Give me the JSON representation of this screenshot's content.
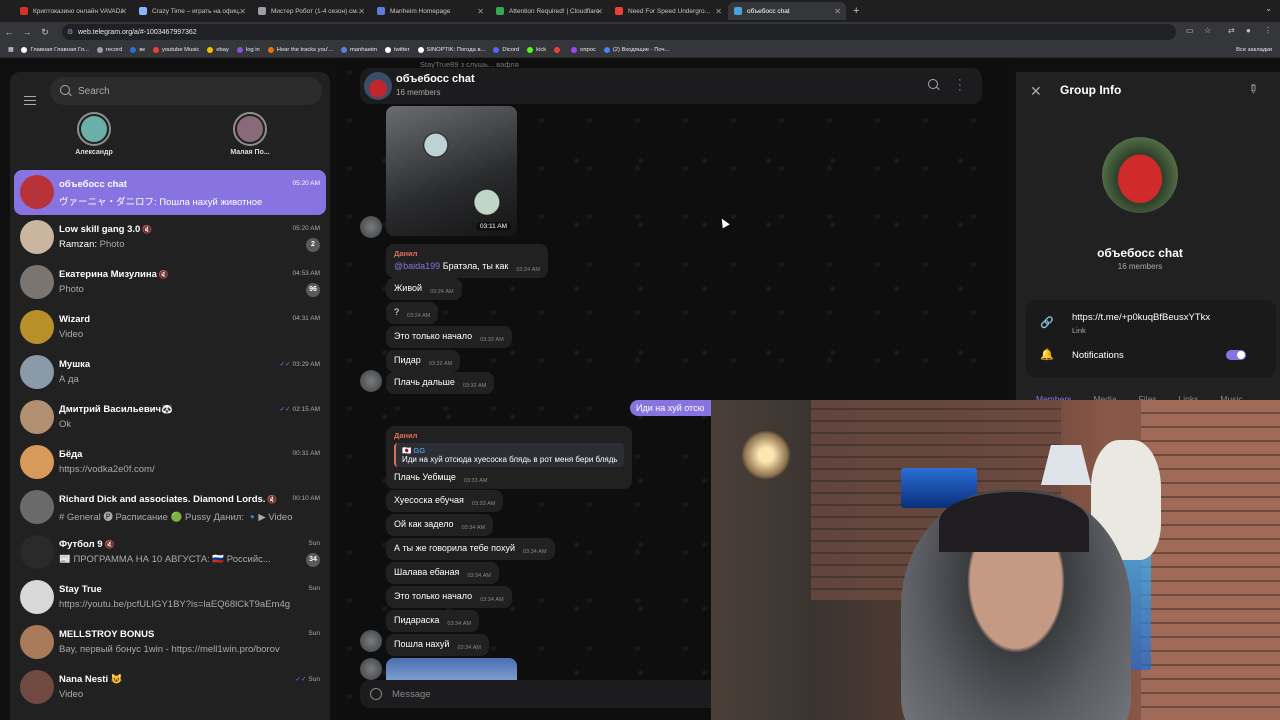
{
  "browser": {
    "tabs": [
      {
        "title": "Криптоказино онлайн VAVADA",
        "color": "#d93025"
      },
      {
        "title": "Crazy Time – играть на офиц...",
        "color": "#8ab4f8"
      },
      {
        "title": "Мистер Робот (1-4 сезон) см...",
        "color": "#9aa0a6"
      },
      {
        "title": "Manheim Homepage",
        "color": "#5b7fd6"
      },
      {
        "title": "Attention Required! | Cloudflare",
        "color": "#34a853"
      },
      {
        "title": "Need For Speed Undergro...",
        "color": "#ea4335"
      },
      {
        "title": "объебосс chat",
        "color": "#4aa3df"
      }
    ],
    "url": "web.telegram.org/a/#-1003467997362",
    "bookmarks": [
      {
        "label": "Главная Главная Гл...",
        "color": "#fff"
      },
      {
        "label": "record",
        "color": "#9aa0a6"
      },
      {
        "label": "вк",
        "color": "#2a6fd6"
      },
      {
        "label": "youtube Music",
        "color": "#ea4335"
      },
      {
        "label": "ebay",
        "color": "#fbbc04"
      },
      {
        "label": "log in",
        "color": "#8a4de0"
      },
      {
        "label": "Hear the tracks you'...",
        "color": "#e8710a"
      },
      {
        "label": "manhaeim",
        "color": "#5b7fd6"
      },
      {
        "label": "twitter",
        "color": "#fff"
      },
      {
        "label": "SINOPTIK: Погода в...",
        "color": "#fff"
      },
      {
        "label": "Dicord",
        "color": "#5865f2"
      },
      {
        "label": "kick",
        "color": "#53fc18"
      },
      {
        "label": "",
        "color": "#ea4335"
      },
      {
        "label": "опрос",
        "color": "#a142f4"
      },
      {
        "label": "(2) Входящие - Поч...",
        "color": "#4285f4"
      }
    ],
    "all_bookmarks": "Все закладки"
  },
  "sidebar": {
    "search_placeholder": "Search",
    "stories": [
      {
        "name": "Александр",
        "color": "#6ab0a8"
      },
      {
        "name": "Малая По...",
        "color": "#8a6a7a"
      }
    ],
    "chats": [
      {
        "name": "объебосс chat",
        "preview": "ヴァーニャ・ダニロフ: Пошла нахуй животное",
        "time": "05:20 AM",
        "badge": "",
        "avatar": "#b8323a",
        "muted": false,
        "active": true
      },
      {
        "name": "Low skill gang 3.0",
        "sender": "Ramzan:",
        "preview": "Photo",
        "time": "05:20 AM",
        "badge": "2",
        "avatar": "#c9b5a0",
        "muted": true
      },
      {
        "name": "Екатерина Мизулина",
        "preview": "Photo",
        "time": "04:53 AM",
        "badge": "96",
        "avatar": "#7a7570",
        "muted": true
      },
      {
        "name": "Wizard",
        "preview": "Video",
        "time": "04:31 AM",
        "badge": "",
        "avatar": "#b8902a",
        "muted": false
      },
      {
        "name": "Мушка",
        "preview": "А да",
        "time": "03:29 AM",
        "badge": "",
        "avatar": "#8a9aa8",
        "muted": false,
        "read": true
      },
      {
        "name": "Дмитрий Васильевич🐼",
        "preview": "Ok",
        "time": "02:15 AM",
        "badge": "",
        "avatar": "#b09070",
        "muted": false,
        "read": true
      },
      {
        "name": "Бёда",
        "preview": "https://vodka2e0f.com/",
        "time": "00:31 AM",
        "badge": "",
        "avatar": "#d89a5a",
        "muted": false
      },
      {
        "name": "Richard Dick and associates. Diamond Lords.",
        "preview": "# General 🅟 Расписание 🟢 Pussy",
        "preview2": "Данил: 🔹▶ Video",
        "time": "00:10 AM",
        "badge": "",
        "avatar": "#6a6a6a",
        "muted": true
      },
      {
        "name": "Футбол 9",
        "preview": "📰 ПРОГРАММА НА 10 АВГУСТА: 🇷🇺 Российс...",
        "time": "Sun",
        "badge": "34",
        "avatar": "#2a2a2a",
        "muted": true
      },
      {
        "name": "Stay True",
        "preview": "https://youtu.be/pcfULIGY1BY?is=laEQ68lCkT9aEm4g",
        "time": "Sun",
        "badge": "",
        "avatar": "#d8d8d8",
        "muted": false
      },
      {
        "name": "MELLSTROY BONUS",
        "preview": "Bay, первый бонус 1win - https://mell1win.pro/borov",
        "time": "Sun",
        "badge": "",
        "avatar": "#a87a5a",
        "muted": false
      },
      {
        "name": "Nana Nesti 😺",
        "preview": "Video",
        "time": "Sun",
        "badge": "",
        "avatar": "#704a40",
        "muted": false,
        "read": true
      }
    ]
  },
  "chat": {
    "title": "объебосс chat",
    "members": "16 members",
    "header_sender": "StayTrue89 з слушь...  вафля",
    "photo_time": "03:11 AM",
    "messages": [
      {
        "author": "Данил",
        "mention": "@baida199",
        "text": "Братэла, ты как",
        "time": "03:24 AM"
      },
      {
        "text": "Живой",
        "time": "03:24 AM"
      },
      {
        "text": "?",
        "time": "03:24 AM"
      },
      {
        "text": "Это только начало",
        "time": "03:32 AM"
      },
      {
        "text": "Пидар",
        "time": "03:32 AM"
      },
      {
        "text": "Плачь дальше",
        "time": "03:32 AM"
      },
      {
        "text": "Иди на хуй отсю",
        "time": "",
        "out": true
      },
      {
        "author": "Данил",
        "reply_name": "🇯🇵 GG",
        "reply_text": "Иди на хуй отсюда хуесоска блядь в рот меня бери блядь",
        "text": "Плачь Уебмще",
        "time": "03:33 AM"
      },
      {
        "text": "Хуесоска ебучая",
        "time": "03:33 AM"
      },
      {
        "text": "Ой как задело",
        "time": "03:34 AM"
      },
      {
        "text": "А ты же говорила тебе похуй",
        "time": "03:34 AM"
      },
      {
        "text": "Шалава ебаная",
        "time": "03:34 AM"
      },
      {
        "text": "Это только начало",
        "time": "03:34 AM"
      },
      {
        "text": "Пидараска",
        "time": "03:34 AM"
      },
      {
        "text": "Пошла нахуй",
        "time": "03:34 AM"
      }
    ],
    "composer_placeholder": "Message"
  },
  "group_info": {
    "title": "Group Info",
    "name": "объебосс chat",
    "members": "16 members",
    "link": "https://t.me/+p0kuqBfBeusxYTkx",
    "link_label": "Link",
    "notifications_label": "Notifications",
    "notifications_on": true,
    "tabs": [
      "Members",
      "Media",
      "Files",
      "Links",
      "Music"
    ]
  }
}
